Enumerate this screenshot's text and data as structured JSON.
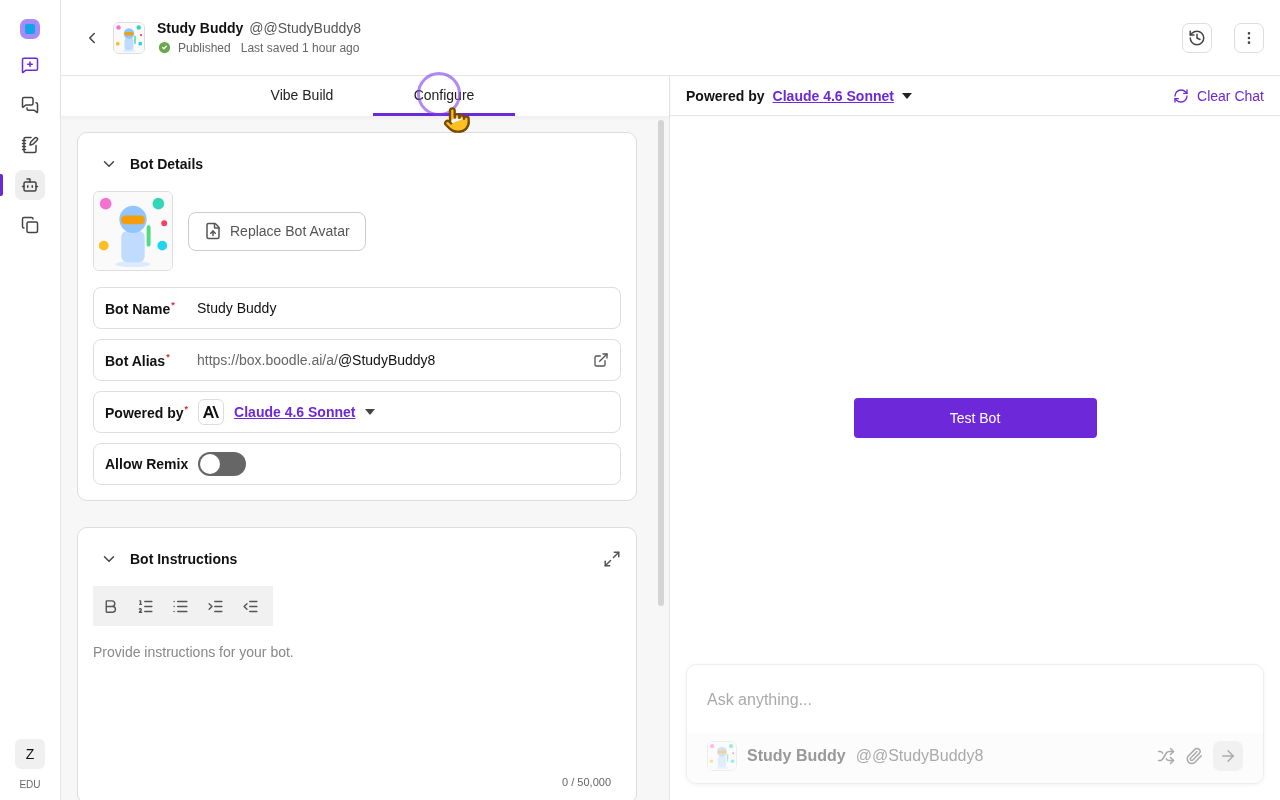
{
  "rail": {
    "items": [
      {
        "selected": false
      },
      {
        "selected": false
      },
      {
        "selected": false
      },
      {
        "selected": true
      },
      {
        "selected": false
      }
    ],
    "user_initial": "Z",
    "plan": "EDU"
  },
  "header": {
    "title": "Study Buddy",
    "handle": "@@StudyBuddy8",
    "status": "Published",
    "saved": "Last saved 1 hour ago"
  },
  "tabs": [
    {
      "label": "Vibe Build",
      "selected": false
    },
    {
      "label": "Configure",
      "selected": true
    }
  ],
  "bot_details": {
    "title": "Bot Details",
    "expanded": true,
    "replace_button": "Replace Bot Avatar",
    "fields": [
      {
        "kind": "text",
        "label": "Bot Name",
        "mark": "*",
        "value": "Study Buddy"
      },
      {
        "kind": "alias",
        "label": "Bot Alias",
        "mark": "*",
        "prefix": "https://box.boodle.ai/a/",
        "value": "@StudyBuddy8"
      },
      {
        "kind": "model",
        "label": "Powered by",
        "mark": "*",
        "value": "Claude 4.6 Sonnet"
      },
      {
        "kind": "toggle",
        "label": "Allow Remix",
        "on": false
      }
    ]
  },
  "instructions": {
    "title": "Bot Instructions",
    "expanded": true,
    "placeholder": "Provide instructions for your bot.",
    "counter": "0 / 50,000"
  },
  "chat": {
    "powered_label": "Powered by",
    "model": "Claude 4.6 Sonnet",
    "clear": "Clear Chat",
    "test_button": "Test Bot",
    "placeholder": "Ask anything...",
    "bot_name": "Study Buddy",
    "bot_handle": "@@StudyBuddy8"
  }
}
